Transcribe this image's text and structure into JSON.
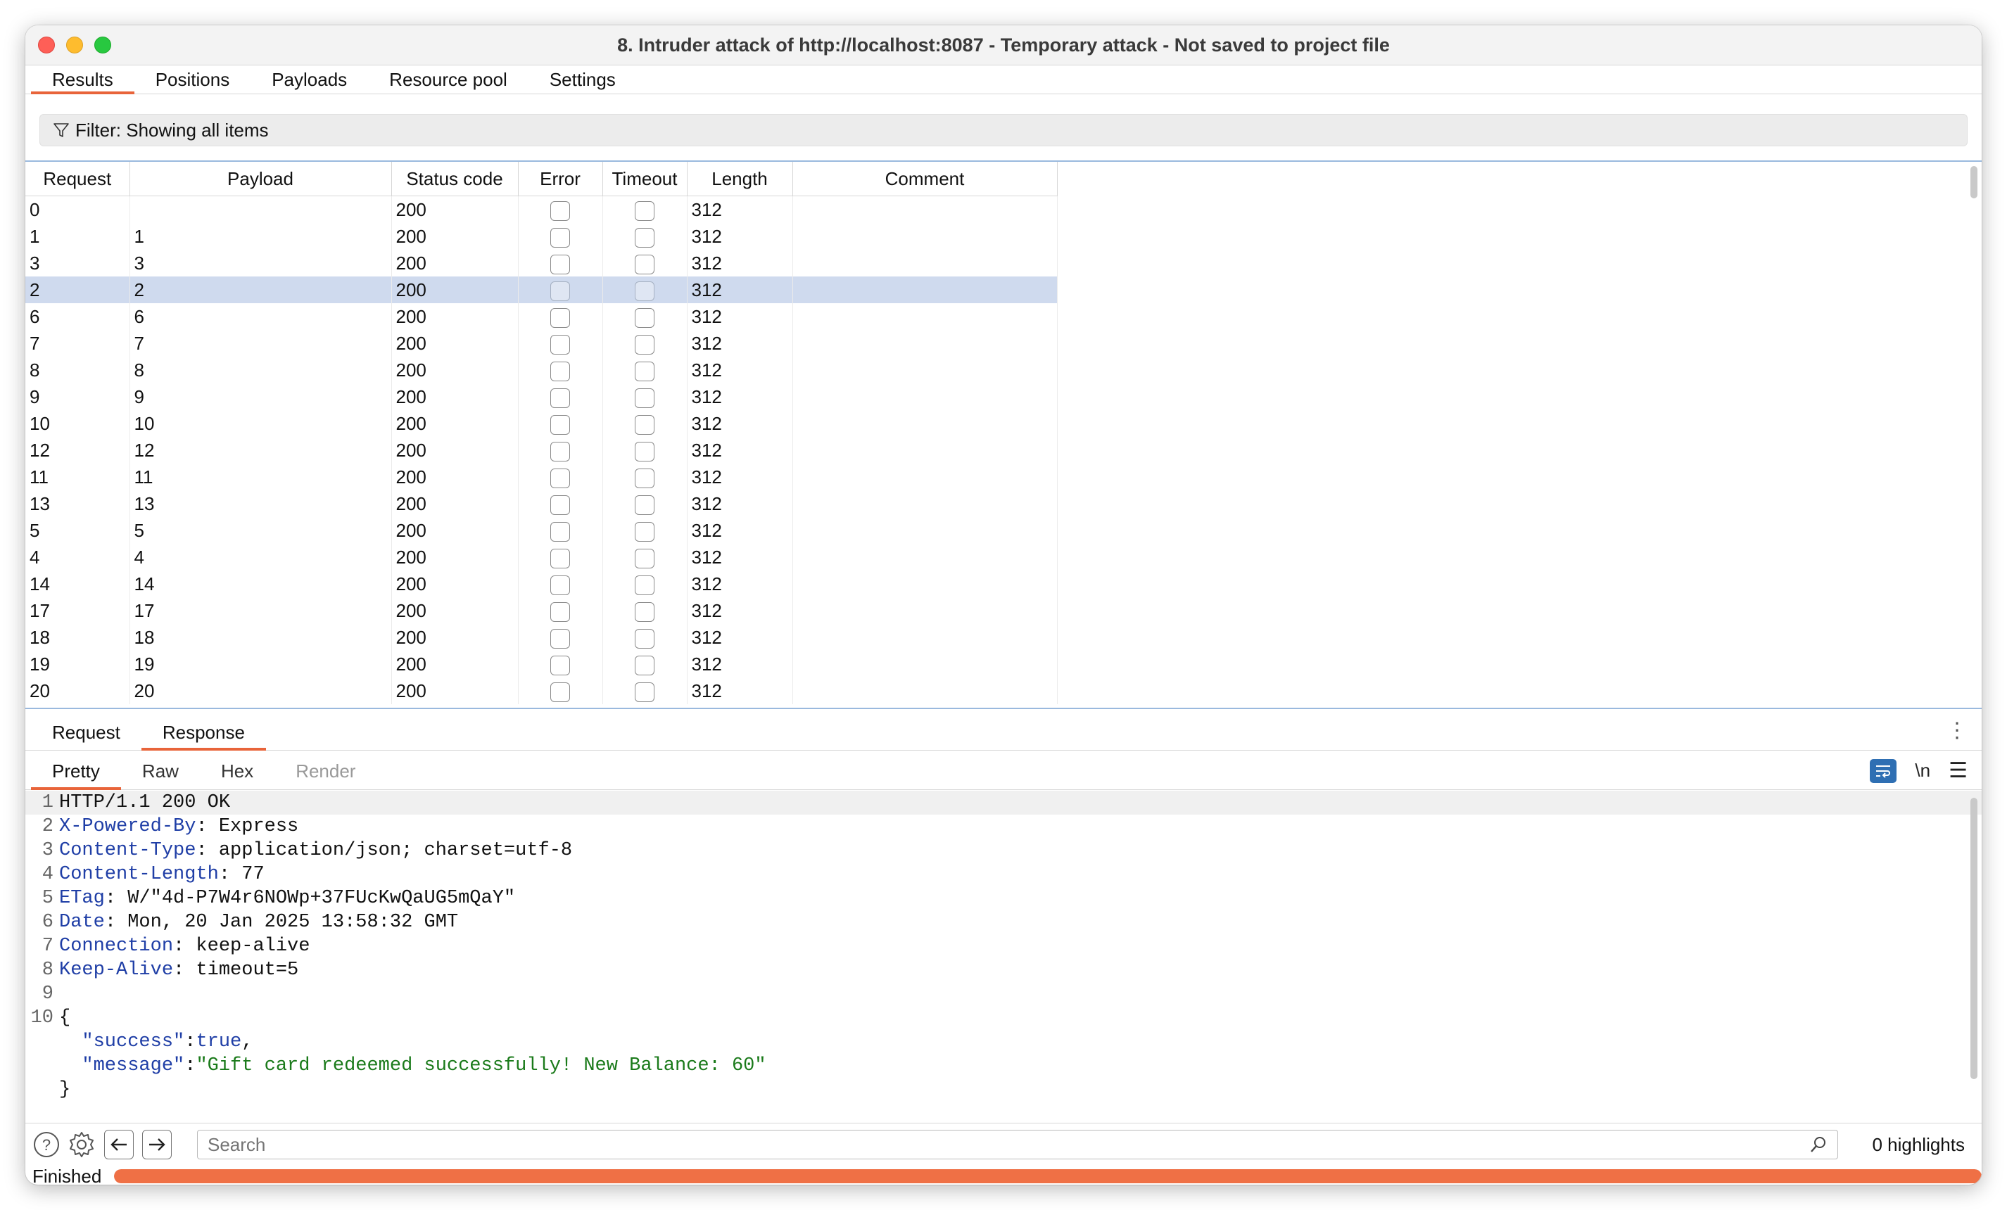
{
  "window": {
    "title": "8. Intruder attack of http://localhost:8087 - Temporary attack - Not saved to project file"
  },
  "tabs": [
    "Results",
    "Positions",
    "Payloads",
    "Resource pool",
    "Settings"
  ],
  "filter": {
    "label": "Filter: Showing all items"
  },
  "table": {
    "columns": [
      "Request",
      "Payload",
      "Status code",
      "Error",
      "Timeout",
      "Length",
      "Comment"
    ],
    "selected_row": 3,
    "rows": [
      {
        "request": "0",
        "payload": "",
        "status": "200",
        "error": false,
        "timeout": false,
        "length": "312",
        "comment": ""
      },
      {
        "request": "1",
        "payload": "1",
        "status": "200",
        "error": false,
        "timeout": false,
        "length": "312",
        "comment": ""
      },
      {
        "request": "3",
        "payload": "3",
        "status": "200",
        "error": false,
        "timeout": false,
        "length": "312",
        "comment": ""
      },
      {
        "request": "2",
        "payload": "2",
        "status": "200",
        "error": false,
        "timeout": false,
        "length": "312",
        "comment": ""
      },
      {
        "request": "6",
        "payload": "6",
        "status": "200",
        "error": false,
        "timeout": false,
        "length": "312",
        "comment": ""
      },
      {
        "request": "7",
        "payload": "7",
        "status": "200",
        "error": false,
        "timeout": false,
        "length": "312",
        "comment": ""
      },
      {
        "request": "8",
        "payload": "8",
        "status": "200",
        "error": false,
        "timeout": false,
        "length": "312",
        "comment": ""
      },
      {
        "request": "9",
        "payload": "9",
        "status": "200",
        "error": false,
        "timeout": false,
        "length": "312",
        "comment": ""
      },
      {
        "request": "10",
        "payload": "10",
        "status": "200",
        "error": false,
        "timeout": false,
        "length": "312",
        "comment": ""
      },
      {
        "request": "12",
        "payload": "12",
        "status": "200",
        "error": false,
        "timeout": false,
        "length": "312",
        "comment": ""
      },
      {
        "request": "11",
        "payload": "11",
        "status": "200",
        "error": false,
        "timeout": false,
        "length": "312",
        "comment": ""
      },
      {
        "request": "13",
        "payload": "13",
        "status": "200",
        "error": false,
        "timeout": false,
        "length": "312",
        "comment": ""
      },
      {
        "request": "5",
        "payload": "5",
        "status": "200",
        "error": false,
        "timeout": false,
        "length": "312",
        "comment": ""
      },
      {
        "request": "4",
        "payload": "4",
        "status": "200",
        "error": false,
        "timeout": false,
        "length": "312",
        "comment": ""
      },
      {
        "request": "14",
        "payload": "14",
        "status": "200",
        "error": false,
        "timeout": false,
        "length": "312",
        "comment": ""
      },
      {
        "request": "17",
        "payload": "17",
        "status": "200",
        "error": false,
        "timeout": false,
        "length": "312",
        "comment": ""
      },
      {
        "request": "18",
        "payload": "18",
        "status": "200",
        "error": false,
        "timeout": false,
        "length": "312",
        "comment": ""
      },
      {
        "request": "19",
        "payload": "19",
        "status": "200",
        "error": false,
        "timeout": false,
        "length": "312",
        "comment": ""
      },
      {
        "request": "20",
        "payload": "20",
        "status": "200",
        "error": false,
        "timeout": false,
        "length": "312",
        "comment": ""
      }
    ]
  },
  "detail_tabs": [
    "Request",
    "Response"
  ],
  "view_tabs": [
    "Pretty",
    "Raw",
    "Hex",
    "Render"
  ],
  "view_icons": {
    "newline_label": "\\n"
  },
  "response": {
    "lines": [
      {
        "n": "1",
        "parts": [
          {
            "t": "HTTP/1.1 200 OK",
            "c": ""
          }
        ]
      },
      {
        "n": "2",
        "parts": [
          {
            "t": "X-Powered-By",
            "c": "hk"
          },
          {
            "t": ": Express",
            "c": ""
          }
        ]
      },
      {
        "n": "3",
        "parts": [
          {
            "t": "Content-Type",
            "c": "hk"
          },
          {
            "t": ": application/json; charset=utf-8",
            "c": ""
          }
        ]
      },
      {
        "n": "4",
        "parts": [
          {
            "t": "Content-Length",
            "c": "hk"
          },
          {
            "t": ": 77",
            "c": ""
          }
        ]
      },
      {
        "n": "5",
        "parts": [
          {
            "t": "ETag",
            "c": "hk"
          },
          {
            "t": ": W/\"4d-P7W4r6NOWp+37FUcKwQaUG5mQaY\"",
            "c": ""
          }
        ]
      },
      {
        "n": "6",
        "parts": [
          {
            "t": "Date",
            "c": "hk"
          },
          {
            "t": ": Mon, 20 Jan 2025 13:58:32 GMT",
            "c": ""
          }
        ]
      },
      {
        "n": "7",
        "parts": [
          {
            "t": "Connection",
            "c": "hk"
          },
          {
            "t": ": keep-alive",
            "c": ""
          }
        ]
      },
      {
        "n": "8",
        "parts": [
          {
            "t": "Keep-Alive",
            "c": "hk"
          },
          {
            "t": ": timeout=5",
            "c": ""
          }
        ]
      },
      {
        "n": "9",
        "parts": []
      },
      {
        "n": "10",
        "parts": [
          {
            "t": "{",
            "c": ""
          }
        ]
      },
      {
        "n": "",
        "parts": [
          {
            "t": "  ",
            "c": ""
          },
          {
            "t": "\"success\"",
            "c": "jk"
          },
          {
            "t": ":",
            "c": ""
          },
          {
            "t": "true",
            "c": "jv"
          },
          {
            "t": ",",
            "c": ""
          }
        ]
      },
      {
        "n": "",
        "parts": [
          {
            "t": "  ",
            "c": ""
          },
          {
            "t": "\"message\"",
            "c": "jk"
          },
          {
            "t": ":",
            "c": ""
          },
          {
            "t": "\"Gift card redeemed successfully! New Balance: 60\"",
            "c": "js"
          }
        ]
      },
      {
        "n": "",
        "parts": [
          {
            "t": "}",
            "c": ""
          }
        ]
      }
    ]
  },
  "search": {
    "placeholder": "Search",
    "value": "",
    "highlights": "0 highlights"
  },
  "status": {
    "text": "Finished",
    "progress": 1.0
  },
  "colors": {
    "accent": "#e8643a",
    "progress": "#ef7045",
    "selection": "#cfdaee",
    "header_key": "#1f3ea6",
    "json_string": "#1a7a1a"
  }
}
